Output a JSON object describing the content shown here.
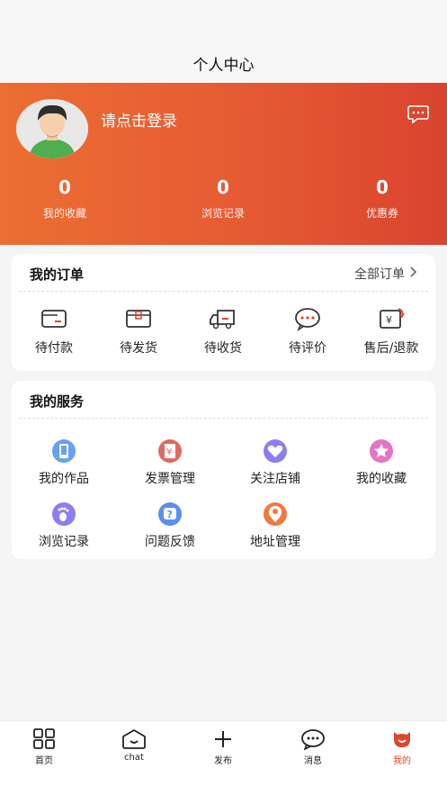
{
  "page": {
    "title": "个人中心"
  },
  "profile": {
    "login_text": "请点击登录"
  },
  "stats": [
    {
      "value": "0",
      "label": "我的收藏"
    },
    {
      "value": "0",
      "label": "浏览记录"
    },
    {
      "value": "0",
      "label": "优惠券"
    }
  ],
  "orders": {
    "title": "我的订单",
    "all_label": "全部订单",
    "items": [
      {
        "label": "待付款",
        "icon": "wallet-icon"
      },
      {
        "label": "待发货",
        "icon": "package-icon"
      },
      {
        "label": "待收货",
        "icon": "truck-icon"
      },
      {
        "label": "待评价",
        "icon": "comment-icon"
      },
      {
        "label": "售后/退款",
        "icon": "refund-icon"
      }
    ]
  },
  "services": {
    "title": "我的服务",
    "items": [
      {
        "label": "我的作品",
        "icon": "phone-icon",
        "color": "#6aa0f0"
      },
      {
        "label": "发票管理",
        "icon": "invoice-icon",
        "color": "#e06a62"
      },
      {
        "label": "关注店铺",
        "icon": "heart-icon",
        "color": "#8d7ef0"
      },
      {
        "label": "我的收藏",
        "icon": "star-icon",
        "color": "#e574c6"
      },
      {
        "label": "浏览记录",
        "icon": "footprint-icon",
        "color": "#8d7ef0"
      },
      {
        "label": "问题反馈",
        "icon": "question-icon",
        "color": "#5a8ef0"
      },
      {
        "label": "地址管理",
        "icon": "location-icon",
        "color": "#f07a3c"
      }
    ]
  },
  "tabbar": {
    "items": [
      {
        "label": "首页",
        "icon": "home-grid-icon"
      },
      {
        "label": "chat",
        "icon": "chat-icon"
      },
      {
        "label": "发布",
        "icon": "plus-icon"
      },
      {
        "label": "消息",
        "icon": "message-icon"
      },
      {
        "label": "我的",
        "icon": "profile-icon"
      }
    ],
    "active_color": "#e0462c"
  },
  "theme": {
    "header_start": "#ec6e33",
    "header_end": "#d9432f"
  }
}
